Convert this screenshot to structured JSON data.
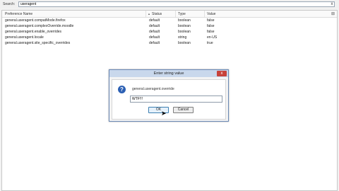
{
  "search": {
    "label": "Search:",
    "value": "useragent",
    "clear_icon": "x"
  },
  "columns": {
    "name": "Preference Name",
    "status": "Status",
    "type": "Type",
    "value": "Value"
  },
  "rows": [
    {
      "name": "general.useragent.compatMode.firefox",
      "status": "default",
      "type": "boolean",
      "value": "false"
    },
    {
      "name": "general.useragent.complexOverride.moodle",
      "status": "default",
      "type": "boolean",
      "value": "false"
    },
    {
      "name": "general.useragent.enable_overrides",
      "status": "default",
      "type": "boolean",
      "value": "false"
    },
    {
      "name": "general.useragent.locale",
      "status": "default",
      "type": "string",
      "value": "en-US"
    },
    {
      "name": "general.useragent.site_specific_overrides",
      "status": "default",
      "type": "boolean",
      "value": "true"
    }
  ],
  "dialog": {
    "title": "Enter string value",
    "prompt": "general.useragent.override",
    "input_value": "WTF!!!",
    "ok_label": "OK",
    "cancel_label": "Cancel",
    "close_icon": "x"
  }
}
